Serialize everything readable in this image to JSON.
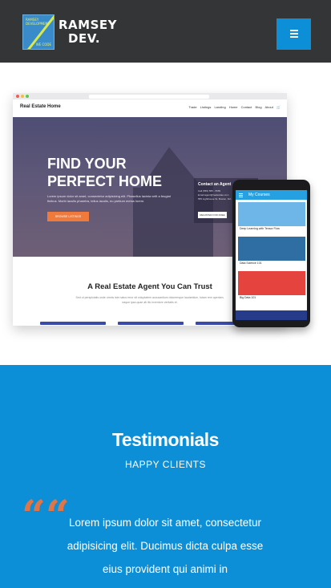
{
  "header": {
    "logo_line1": "RAMSEY",
    "logo_line2": "DEV.",
    "logo_mark_text": "RAMSEY DEVELOPMENT",
    "logo_mark_text2": "WE CODE",
    "menu_icon": "hamburger-icon",
    "colors": {
      "background": "#333537",
      "accent": "#0d8fd7"
    }
  },
  "mockup": {
    "site_brand": "Real Estate Home",
    "nav_links": [
      "Trade",
      "Listings",
      "Landing",
      "Home",
      "Contact",
      "Blog",
      "About"
    ],
    "cart_icon": "cart-icon",
    "hero_title_line1": "FIND YOUR",
    "hero_title_line2": "PERFECT HOME",
    "hero_text": "Lorem ipsum dolor sit amet, consectetur adipisicing elit. Phasellus lacinia velit a feugiat finibus. Morbi iaculis pharetra, tellus iaculis, eu pretium metus lorem.",
    "hero_button": "BROWSE LISTINGS",
    "agent_card_title": "Contact an Agent",
    "agent_card_lines": [
      "Call (555) 555 - 5555",
      "Email agent@realestate.com",
      "555 Lighthouse St, Boston, MA"
    ],
    "agent_card_button": "REGISTER FOR FREE",
    "section_title": "A Real Estate Agent You Can Trust",
    "section_text": "Sed ut perspiciatis unde omnis iste natus error sit voluptatem accusantium doloremque laudantium, totam rem aperiam, eaque ipsa quae ab illo inventore veritatis et."
  },
  "phone": {
    "app_title": "My Courses",
    "courses": [
      {
        "label": "Deep Learning with Tensor Flow",
        "color": "#6fb6e8"
      },
      {
        "label": "Data Science 101",
        "color": "#2f6ea3"
      },
      {
        "label": "Big Data 101",
        "color": "#e4433e"
      }
    ]
  },
  "testimonials": {
    "title": "Testimonials",
    "subtitle": "HAPPY CLIENTS",
    "quote_icon": "quote-icon",
    "quote_mark": "““",
    "text": "Lorem ipsum dolor sit amet, consectetur adipisicing elit. Ducimus dicta culpa esse eius provident qui animi in",
    "colors": {
      "background": "#0d8fd7",
      "quote": "#e07548"
    }
  }
}
